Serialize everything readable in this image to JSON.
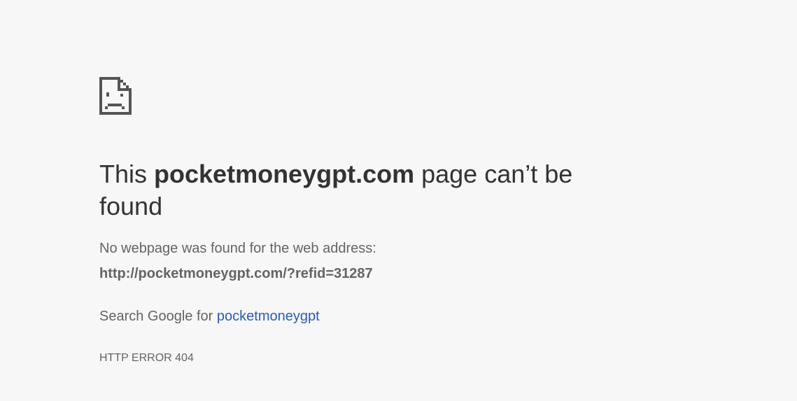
{
  "icon": {
    "name": "sad-page-icon",
    "color": "#555555"
  },
  "heading": {
    "prefix": "This",
    "domain": "pocketmoneygpt.com",
    "suffix": "page can’t be found"
  },
  "description": "No webpage was found for the web address:",
  "url": "http://pocketmoneygpt.com/?refid=31287",
  "search": {
    "prefix": "Search Google for",
    "link_text": "pocketmoneygpt",
    "link_color": "#2a5db0"
  },
  "error_code": "HTTP ERROR 404",
  "colors": {
    "background": "#f7f7f7",
    "heading": "#333333",
    "body_text": "#646464"
  }
}
